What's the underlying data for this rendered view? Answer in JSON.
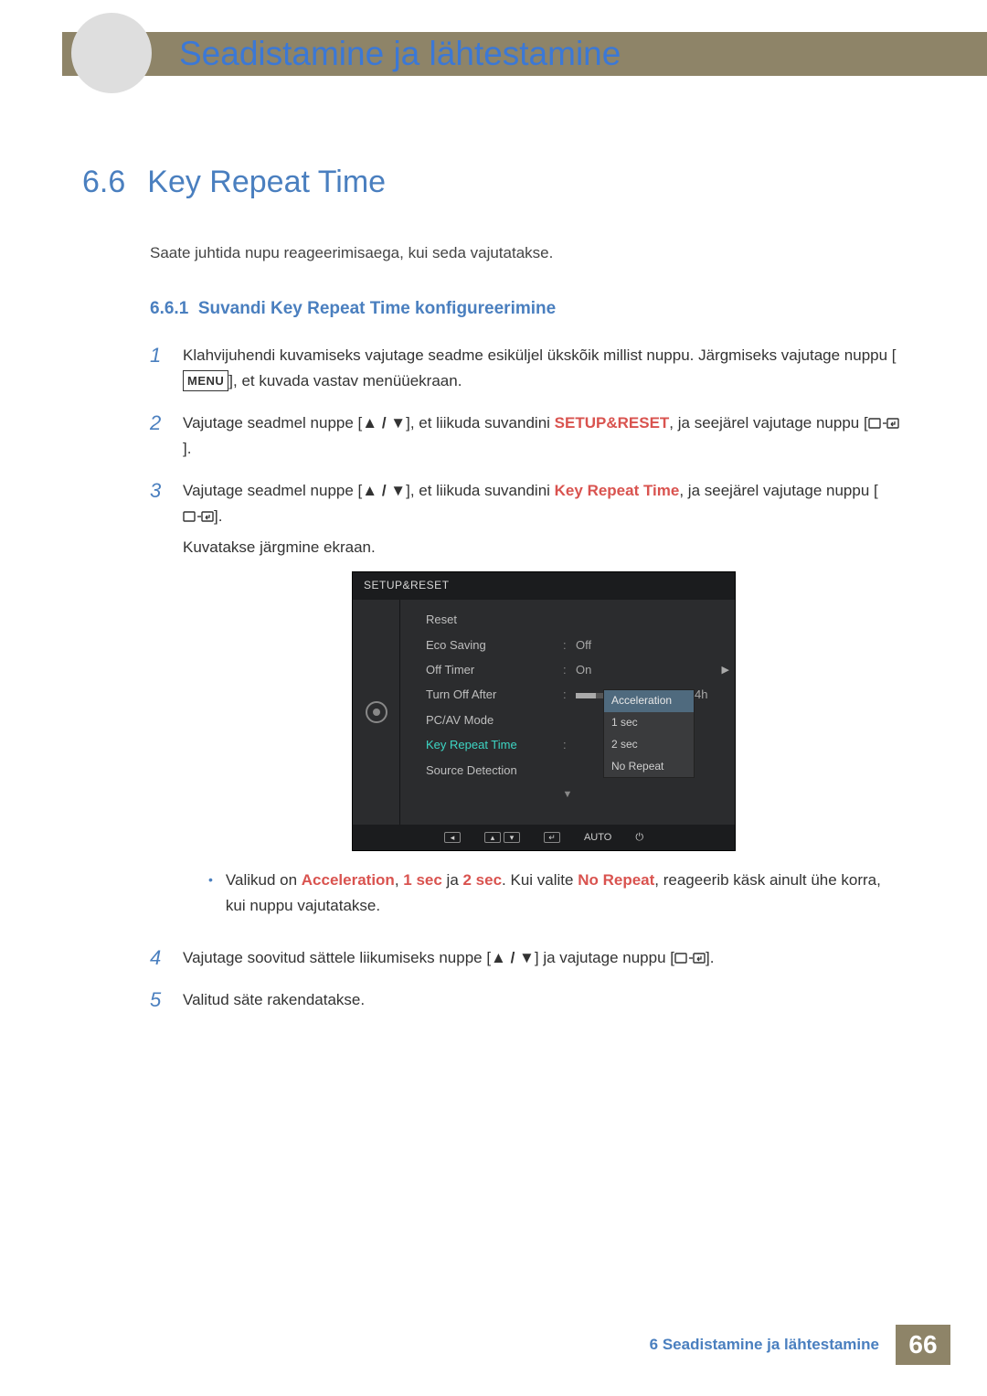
{
  "header": {
    "chapter_title": "Seadistamine ja lähtestamine"
  },
  "section": {
    "number": "6.6",
    "title": "Key Repeat Time",
    "intro": "Saate juhtida nupu reageerimisaega, kui seda vajutatakse."
  },
  "subsection": {
    "number": "6.6.1",
    "title": "Suvandi Key Repeat Time konfigureerimine"
  },
  "buttons": {
    "menu": "MENU"
  },
  "steps": {
    "s1": {
      "num": "1",
      "t1": "Klahvijuhendi kuvamiseks vajutage seadme esiküljel ükskõik millist nuppu. Järgmiseks vajutage nuppu [",
      "t2": "], et kuvada vastav menüüekraan."
    },
    "s2": {
      "num": "2",
      "t1": "Vajutage seadmel nuppe [",
      "t2": "], et liikuda suvandini ",
      "kw": "SETUP&RESET",
      "t3": ", ja seejärel vajutage nuppu [",
      "t4": "]."
    },
    "s3": {
      "num": "3",
      "t1": "Vajutage seadmel nuppe [",
      "t2": "], et liikuda suvandini ",
      "kw": "Key Repeat Time",
      "t3": ", ja seejärel vajutage nuppu [",
      "t4": "].",
      "caption": "Kuvatakse järgmine ekraan."
    },
    "bullet": {
      "t1": "Valikud on ",
      "k1": "Acceleration",
      "c1": ", ",
      "k2": "1 sec",
      "c2": " ja ",
      "k3": "2 sec",
      "t2": ". Kui valite ",
      "k4": "No Repeat",
      "t3": ", reageerib käsk ainult ühe korra, kui nuppu vajutatakse."
    },
    "s4": {
      "num": "4",
      "t1": "Vajutage soovitud sättele liikumiseks nuppe [",
      "t2": "] ja vajutage nuppu [",
      "t3": "]."
    },
    "s5": {
      "num": "5",
      "t1": "Valitud säte rakendatakse."
    }
  },
  "osd": {
    "title": "SETUP&RESET",
    "rows": {
      "reset": "Reset",
      "eco": "Eco Saving",
      "eco_val": "Off",
      "off_timer": "Off Timer",
      "off_timer_val": "On",
      "turn_off": "Turn Off After",
      "turn_off_val": "4h",
      "pcav": "PC/AV Mode",
      "krt": "Key Repeat Time",
      "src": "Source Detection"
    },
    "dropdown": {
      "o1": "Acceleration",
      "o2": "1 sec",
      "o3": "2 sec",
      "o4": "No Repeat"
    },
    "footer": {
      "auto": "AUTO"
    }
  },
  "footer": {
    "text": "6 Seadistamine ja lähtestamine",
    "page": "66"
  },
  "glyphs": {
    "updown": "▲ / ▼"
  }
}
